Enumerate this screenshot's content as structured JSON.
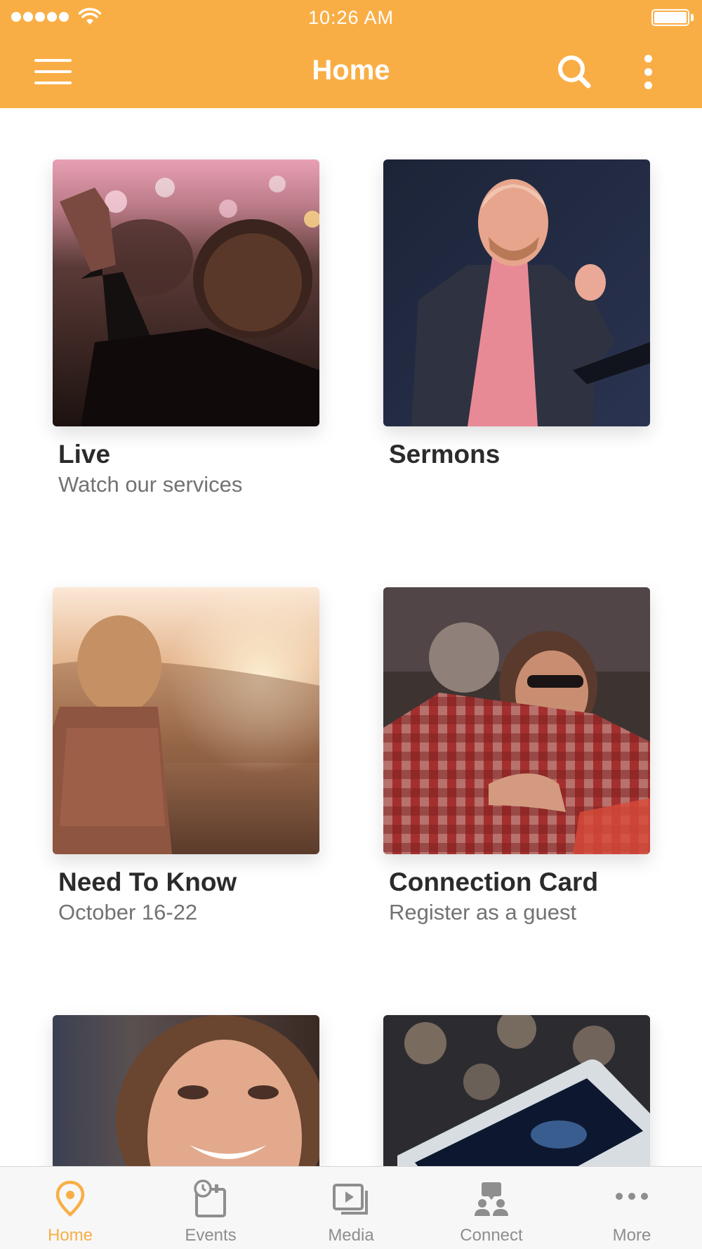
{
  "status_bar": {
    "time": "10:26 AM",
    "signal_bars": 5
  },
  "nav": {
    "title": "Home",
    "menu_icon": "hamburger-menu-icon",
    "search_icon": "search-icon",
    "more_icon": "vertical-dots-icon"
  },
  "colors": {
    "brand": "#f9ae45",
    "title_text": "#2b2b2b",
    "subtitle_text": "#727272",
    "tab_inactive": "#8e8e8e"
  },
  "tiles": [
    {
      "title": "Live",
      "subtitle": "Watch our services",
      "image": "worship-crowd-photo"
    },
    {
      "title": "Sermons",
      "subtitle": "",
      "image": "preacher-photo"
    },
    {
      "title": "Need To Know",
      "subtitle": "October 16-22",
      "image": "sunset-woman-photo"
    },
    {
      "title": "Connection Card",
      "subtitle": "Register as a guest",
      "image": "hug-photo"
    },
    {
      "title": "",
      "subtitle": "",
      "image": "smiling-girl-photo"
    },
    {
      "title": "",
      "subtitle": "",
      "image": "phone-on-table-photo"
    }
  ],
  "tabbar": {
    "active": "Home",
    "tabs": [
      {
        "label": "Home",
        "icon": "location-pin-icon"
      },
      {
        "label": "Events",
        "icon": "calendar-clock-icon"
      },
      {
        "label": "Media",
        "icon": "media-play-icon"
      },
      {
        "label": "Connect",
        "icon": "people-connect-icon"
      },
      {
        "label": "More",
        "icon": "horizontal-dots-icon"
      }
    ]
  }
}
